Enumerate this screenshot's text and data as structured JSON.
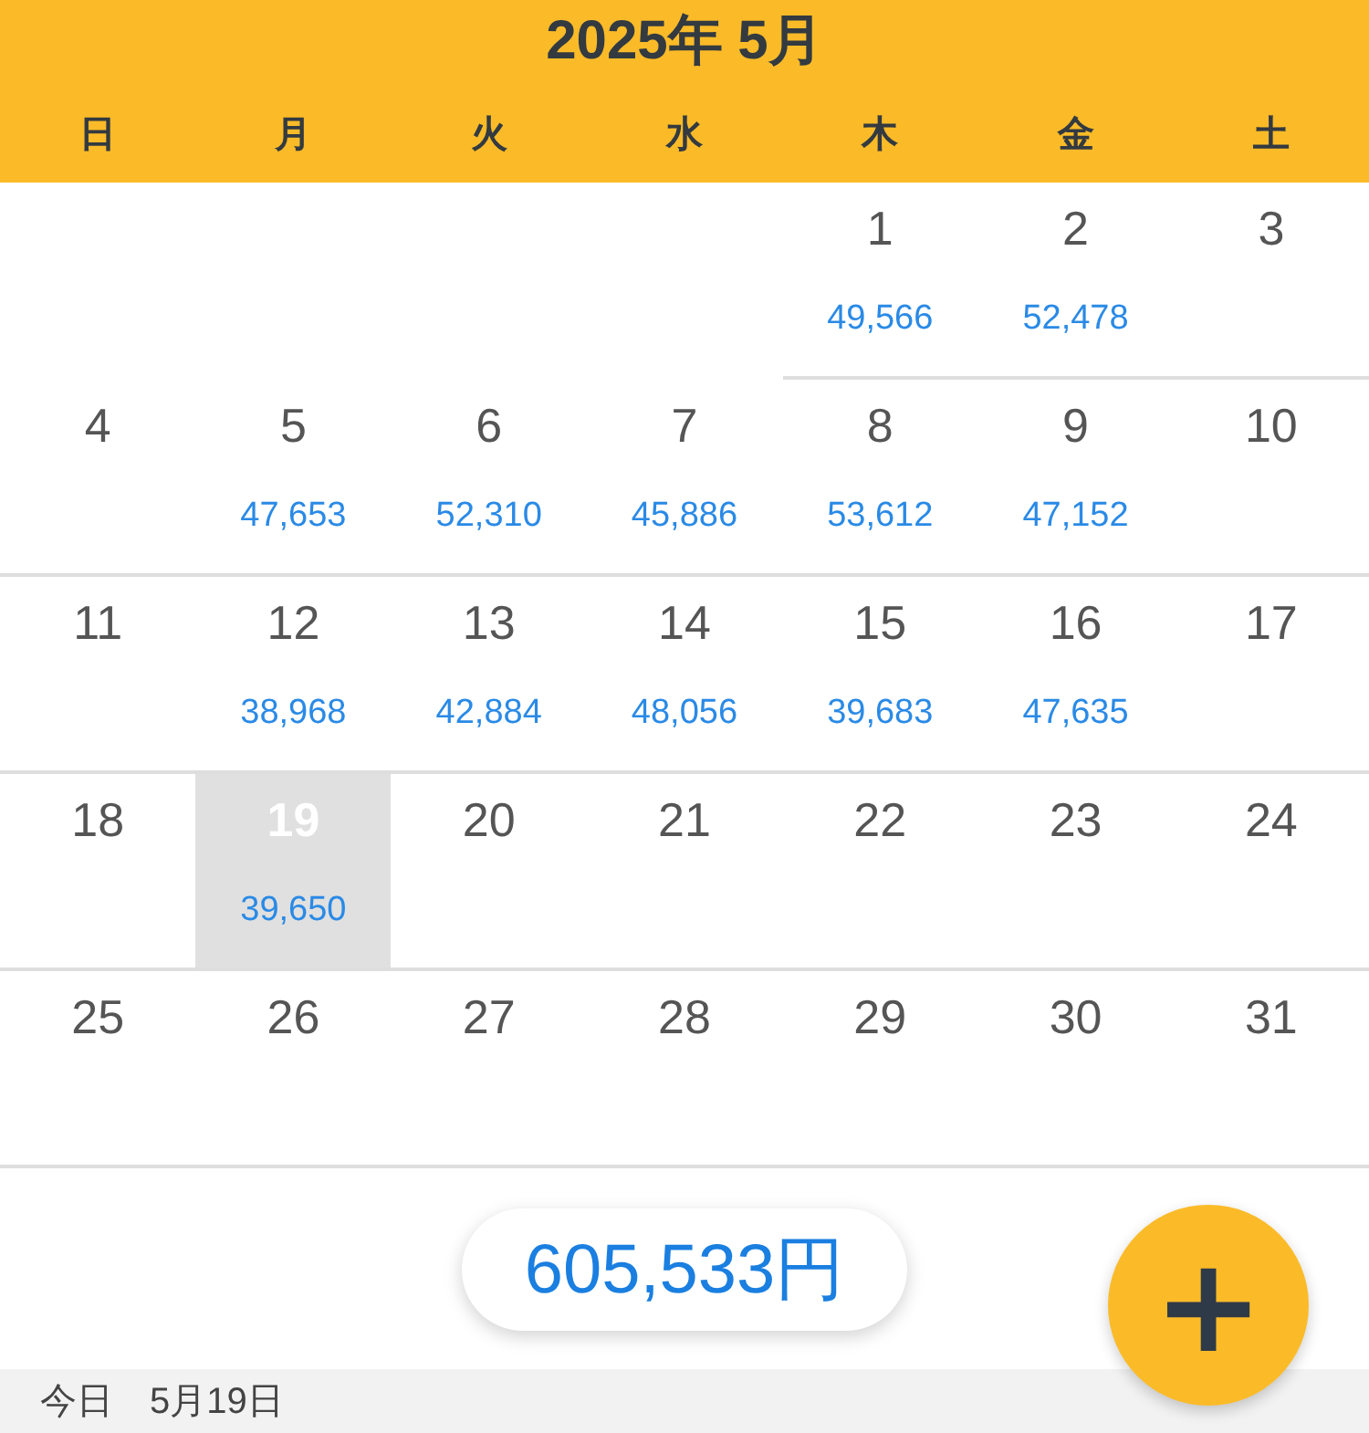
{
  "header": {
    "title": "2025年 5月",
    "weekdays": [
      "日",
      "月",
      "火",
      "水",
      "木",
      "金",
      "土"
    ]
  },
  "weeks": [
    [
      {
        "day": "1",
        "amount": "49,566",
        "selected": false
      },
      {
        "day": "2",
        "amount": "52,478",
        "selected": false
      },
      {
        "day": "3",
        "selected": false
      }
    ],
    [
      {
        "day": "4",
        "selected": false
      },
      {
        "day": "5",
        "amount": "47,653",
        "selected": false
      },
      {
        "day": "6",
        "amount": "52,310",
        "selected": false
      },
      {
        "day": "7",
        "amount": "45,886",
        "selected": false
      },
      {
        "day": "8",
        "amount": "53,612",
        "selected": false
      },
      {
        "day": "9",
        "amount": "47,152",
        "selected": false
      },
      {
        "day": "10",
        "selected": false
      }
    ],
    [
      {
        "day": "11",
        "selected": false
      },
      {
        "day": "12",
        "amount": "38,968",
        "selected": false
      },
      {
        "day": "13",
        "amount": "42,884",
        "selected": false
      },
      {
        "day": "14",
        "amount": "48,056",
        "selected": false
      },
      {
        "day": "15",
        "amount": "39,683",
        "selected": false
      },
      {
        "day": "16",
        "amount": "47,635",
        "selected": false
      },
      {
        "day": "17",
        "selected": false
      }
    ],
    [
      {
        "day": "18",
        "selected": false
      },
      {
        "day": "19",
        "amount": "39,650",
        "selected": true
      },
      {
        "day": "20",
        "selected": false
      },
      {
        "day": "21",
        "selected": false
      },
      {
        "day": "22",
        "selected": false
      },
      {
        "day": "23",
        "selected": false
      },
      {
        "day": "24",
        "selected": false
      }
    ],
    [
      {
        "day": "25",
        "selected": false
      },
      {
        "day": "26",
        "selected": false
      },
      {
        "day": "27",
        "selected": false
      },
      {
        "day": "28",
        "selected": false
      },
      {
        "day": "29",
        "selected": false
      },
      {
        "day": "30",
        "selected": false
      },
      {
        "day": "31",
        "selected": false
      }
    ]
  ],
  "total": "605,533円",
  "add_button": "+",
  "footer_label": "今日　5月19日"
}
